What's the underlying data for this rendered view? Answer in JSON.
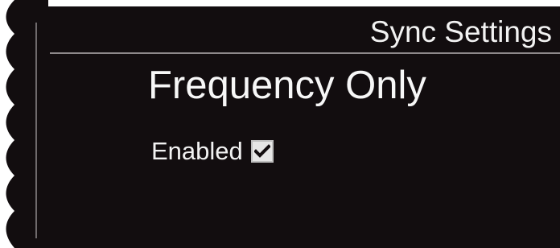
{
  "header": {
    "title": "Sync Settings"
  },
  "main": {
    "mode_label": "Frequency Only",
    "enabled": {
      "label": "Enabled",
      "checked": true
    }
  },
  "icons": {
    "checkbox": "checkmark-icon"
  },
  "colors": {
    "screen_background": "#120d0f",
    "text": "#f2f2f2",
    "rule": "#8e898b"
  }
}
